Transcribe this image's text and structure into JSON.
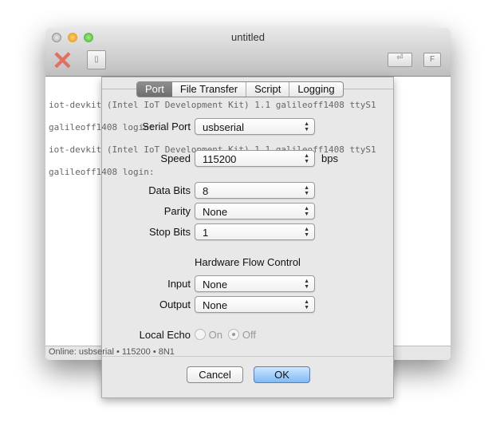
{
  "window": {
    "title": "untitled"
  },
  "toolbar": {
    "disconnect_icon": "red-x-plug-icon",
    "switch_icon": "switch-icon",
    "return_label": "⏎",
    "f_label": "F"
  },
  "terminal": {
    "lines": [
      "iot-devkit (Intel IoT Development Kit) 1.1 galileoff1408 ttyS1",
      "galileoff1408 login:",
      "iot-devkit (Intel IoT Development Kit) 1.1 galileoff1408 ttyS1",
      "galileoff1408 login:"
    ]
  },
  "status": "Online: usbserial • 115200 • 8N1",
  "sheet": {
    "tabs": [
      "Port",
      "File Transfer",
      "Script",
      "Logging"
    ],
    "selected_tab": "Port",
    "serial_port": {
      "label": "Serial Port",
      "value": "usbserial"
    },
    "speed": {
      "label": "Speed",
      "value": "115200",
      "unit": "bps"
    },
    "data_bits": {
      "label": "Data Bits",
      "value": "8"
    },
    "parity": {
      "label": "Parity",
      "value": "None"
    },
    "stop_bits": {
      "label": "Stop Bits",
      "value": "1"
    },
    "flow_heading": "Hardware Flow Control",
    "input": {
      "label": "Input",
      "value": "None"
    },
    "output": {
      "label": "Output",
      "value": "None"
    },
    "local_echo": {
      "label": "Local Echo",
      "on": "On",
      "off": "Off",
      "selected": "Off"
    },
    "cancel": "Cancel",
    "ok": "OK"
  }
}
